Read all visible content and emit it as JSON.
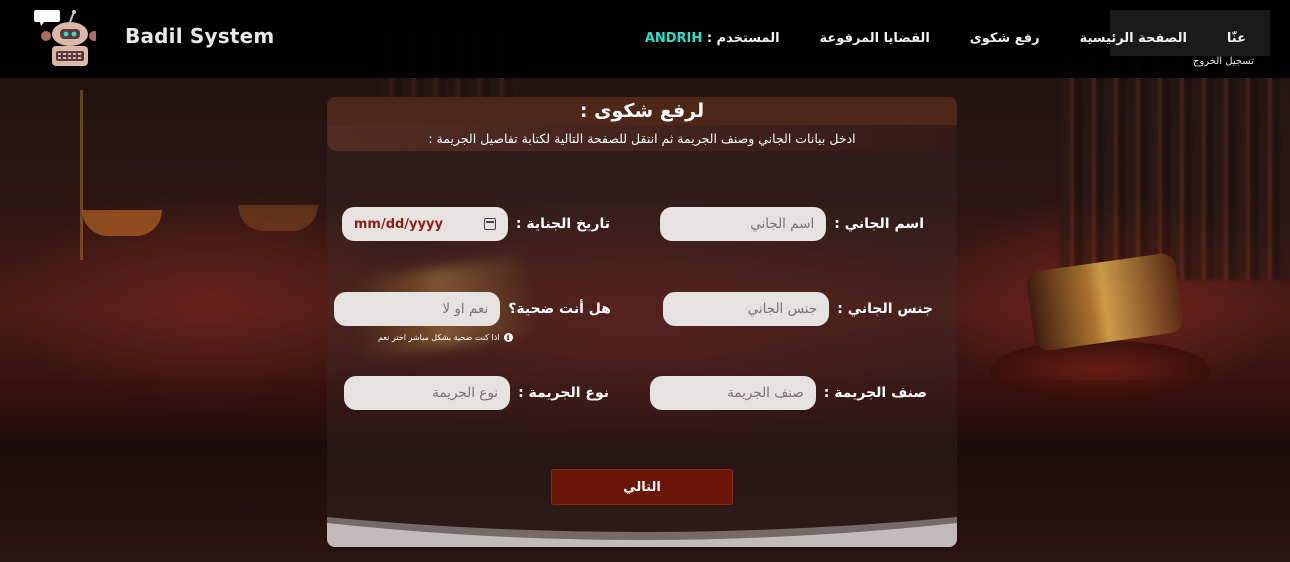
{
  "brand": {
    "name": "Badil System"
  },
  "nav": {
    "user_label": "المستخدم :",
    "user_name": "ANDRIH",
    "links": [
      "القضايا المرفوعة",
      "رفع شكوى",
      "الصفحة الرئيسية",
      "عنّا"
    ],
    "logout": "تسجيل الخروج"
  },
  "form": {
    "title": "لرفع شكوى :",
    "subtitle": "ادخل بيانات الجاني وصنف الجريمة ثم انتقل للصفحة التالية لكتابة تفاصيل الجريمة :",
    "criminal_name": {
      "label": "اسم الجاني :",
      "placeholder": "اسم الجاني"
    },
    "crime_date": {
      "label": "تاريخ الجناية :",
      "placeholder": "mm/dd/yyyy"
    },
    "criminal_gender": {
      "label": "جنس الجاني :",
      "placeholder": "جنس الجاني"
    },
    "is_victim": {
      "label": "هل أنت ضحية؟",
      "placeholder": "نعم او لا",
      "hint": "اذا كنت ضحية بشكل مباشر اختر نعم"
    },
    "crime_category": {
      "label": "صنف الجريمة :",
      "placeholder": "صنف الجريمة"
    },
    "crime_type": {
      "label": "نوع الجريمة :",
      "placeholder": "نوع الجريمة"
    },
    "next_button": "التالي"
  },
  "colors": {
    "title_bar": "#4e2718",
    "button": "#6a1507",
    "username": "#2fe0c8"
  }
}
